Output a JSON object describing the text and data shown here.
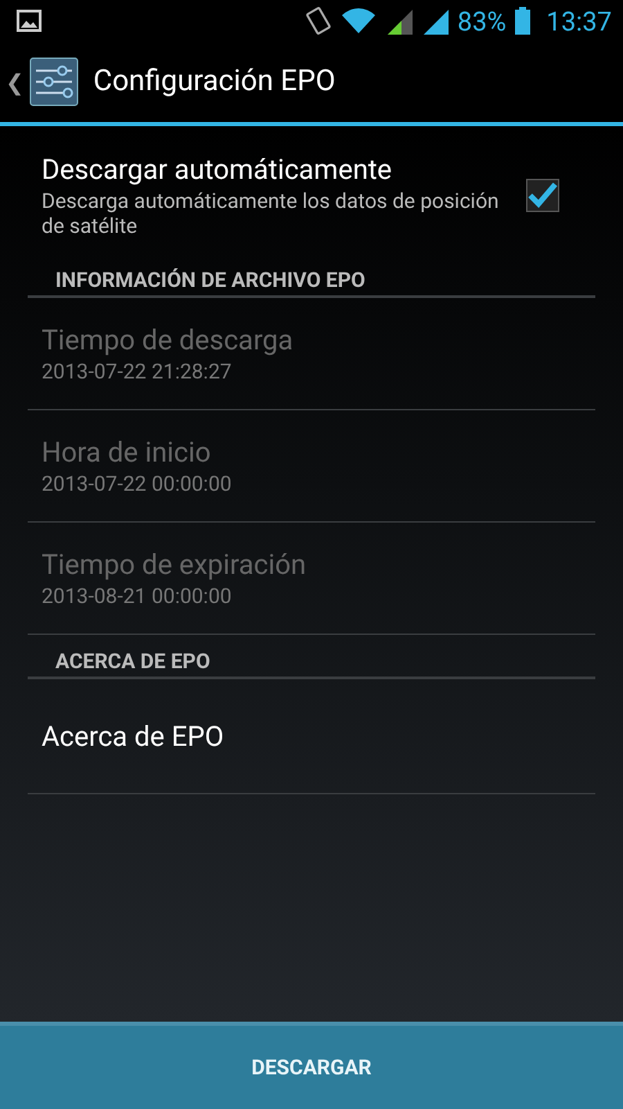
{
  "status_bar": {
    "battery": "83%",
    "time": "13:37"
  },
  "action_bar": {
    "back": "❮",
    "title": "Configuración EPO"
  },
  "preferences": [
    {
      "kind": "checkbox",
      "title": "Descargar automáticamente",
      "summary": "Descarga automáticamente los datos de posición de satélite",
      "checked": true
    },
    {
      "kind": "category",
      "title": "INFORMACIÓN DE ARCHIVO EPO"
    },
    {
      "kind": "info",
      "title": "Tiempo de descarga",
      "summary": "2013-07-22 21:28:27",
      "disabled": true
    },
    {
      "kind": "info",
      "title": "Hora de inicio",
      "summary": "2013-07-22 00:00:00",
      "disabled": true
    },
    {
      "kind": "info",
      "title": "Tiempo de expiración",
      "summary": "2013-08-21 00:00:00",
      "disabled": true
    },
    {
      "kind": "category",
      "title": "ACERCA DE EPO"
    },
    {
      "kind": "info",
      "title": "Acerca de EPO",
      "disabled": false
    }
  ],
  "button": {
    "label": "DESCARGAR"
  }
}
